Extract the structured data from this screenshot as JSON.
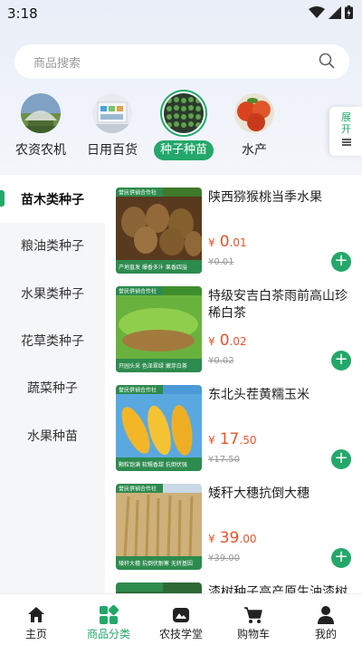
{
  "status": {
    "time": "3:18"
  },
  "search": {
    "placeholder": "商品搜索"
  },
  "categories": [
    {
      "label": "农资农机",
      "icon": "greenhouse-photo"
    },
    {
      "label": "日用百货",
      "icon": "store-photo"
    },
    {
      "label": "种子种苗",
      "icon": "seedling-tray-photo",
      "active": true
    },
    {
      "label": "水产",
      "icon": "fruit-photo"
    }
  ],
  "expand_label": "展开",
  "sidebar": {
    "items": [
      {
        "label": "苗木类种子",
        "active": true
      },
      {
        "label": "粮油类种子"
      },
      {
        "label": "水果类种子"
      },
      {
        "label": "花草类种子"
      },
      {
        "label": "蔬菜种子"
      },
      {
        "label": "水果种苗"
      }
    ]
  },
  "products": [
    {
      "title": "陕西猕猴桃当季水果",
      "price_int": "0",
      "price_dec": ".01",
      "old_price": "¥0.01",
      "badge": "誉民供销合作社",
      "tags": "产地直发  爆香多汁  果香四溢"
    },
    {
      "title": "特级安吉白茶雨前高山珍稀白茶",
      "price_int": "0",
      "price_dec": ".02",
      "old_price": "¥0.02",
      "badge": "誉民供销合作社",
      "tags": "开园头采  色泽翠绿  嫩芽白茶"
    },
    {
      "title": "东北头茬黄糯玉米",
      "price_int": "17",
      "price_dec": ".50",
      "old_price": "¥17.50",
      "badge": "誉民供销合作社",
      "tags": "颗粒饱满  软糯香甜  抗倒伏强"
    },
    {
      "title": "矮秆大穗抗倒大穗",
      "price_int": "39",
      "price_dec": ".00",
      "old_price": "¥39.00",
      "badge": "誉民供销合作社",
      "tags": "矮秆大穗  抗倒伏耐寒  无转基因"
    },
    {
      "title": "漆树种子高产原生油漆树",
      "price_int": "",
      "price_dec": "",
      "old_price": "",
      "badge": "",
      "tags": ""
    }
  ],
  "currency": "¥",
  "tabs": [
    {
      "label": "主页",
      "icon": "home-icon"
    },
    {
      "label": "商品分类",
      "icon": "category-grid-icon",
      "active": true
    },
    {
      "label": "农技学堂",
      "icon": "school-icon"
    },
    {
      "label": "购物车",
      "icon": "cart-icon"
    },
    {
      "label": "我的",
      "icon": "user-icon"
    }
  ],
  "colors": {
    "accent": "#23a86a",
    "price": "#e8542a"
  }
}
